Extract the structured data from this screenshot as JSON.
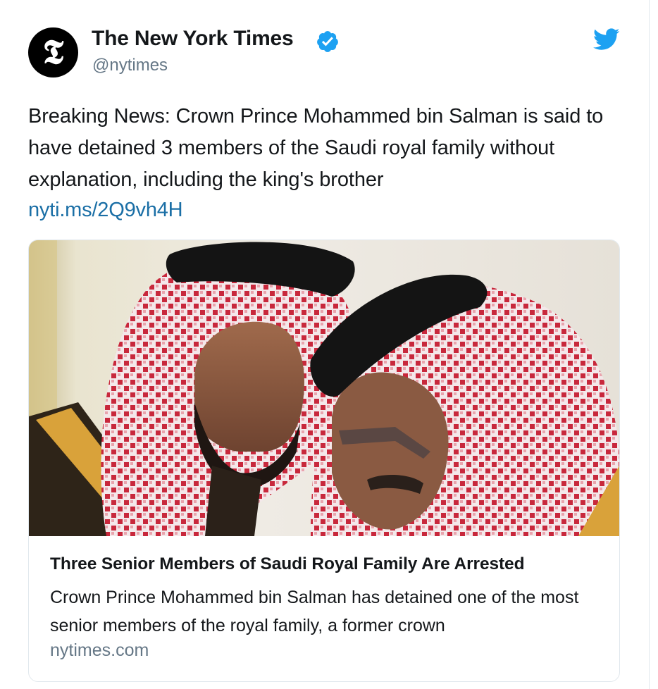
{
  "tweet": {
    "author": {
      "display_name": "The New York Times",
      "handle": "@nytimes",
      "avatar_glyph": "𝕿",
      "verified": true
    },
    "text": "Breaking News: Crown Prince Mohammed bin Salman is said to have detained 3 members of the Saudi royal family without explanation, including the king's brother",
    "link": "nyti.ms/2Q9vh4H",
    "card": {
      "title": "Three Senior Members of Saudi Royal Family Are Arrested",
      "description": "Crown Prince Mohammed bin Salman has detained one of the most senior members of the royal family, a former crown",
      "domain": "nytimes.com",
      "image_icon": "news-photo"
    }
  },
  "colors": {
    "text": "#14171a",
    "secondary": "#657786",
    "link": "#1b6fa6",
    "twitter_blue": "#1da1f2",
    "border": "#e1e8ed"
  },
  "icons": [
    "verified-badge-icon",
    "twitter-bird-icon"
  ]
}
